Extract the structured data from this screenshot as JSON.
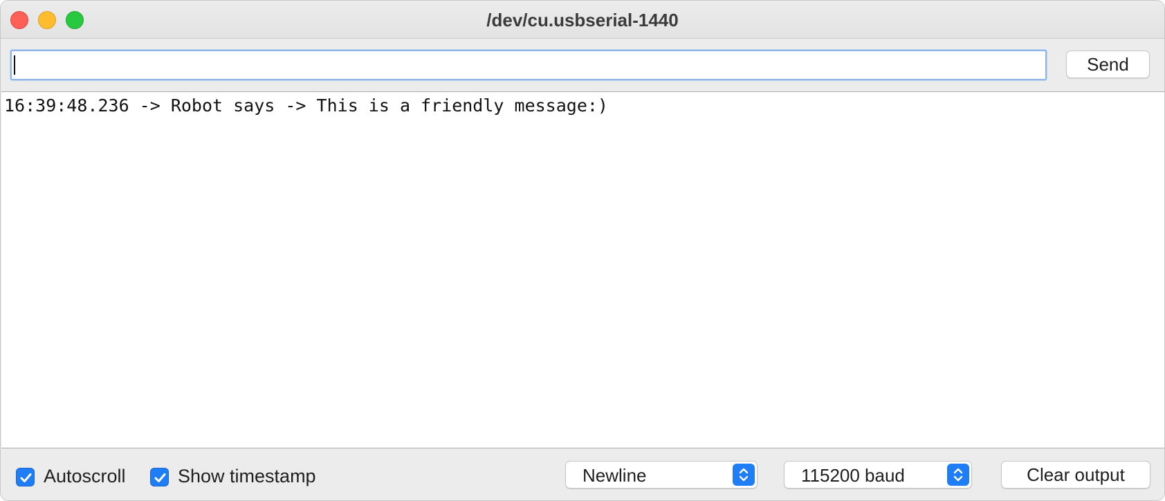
{
  "window": {
    "title": "/dev/cu.usbserial-1440"
  },
  "send_bar": {
    "input_value": "",
    "send_label": "Send"
  },
  "output": {
    "lines": [
      "16:39:48.236 -> Robot says -> This is a friendly message:)"
    ]
  },
  "footer": {
    "autoscroll_label": "Autoscroll",
    "autoscroll_checked": true,
    "timestamp_label": "Show timestamp",
    "timestamp_checked": true,
    "line_ending": "Newline",
    "baud_rate": "115200 baud",
    "clear_label": "Clear output"
  },
  "colors": {
    "accent": "#1f7ef5",
    "close": "#fe5f57",
    "minimize": "#febc2e",
    "zoom": "#28c840"
  }
}
